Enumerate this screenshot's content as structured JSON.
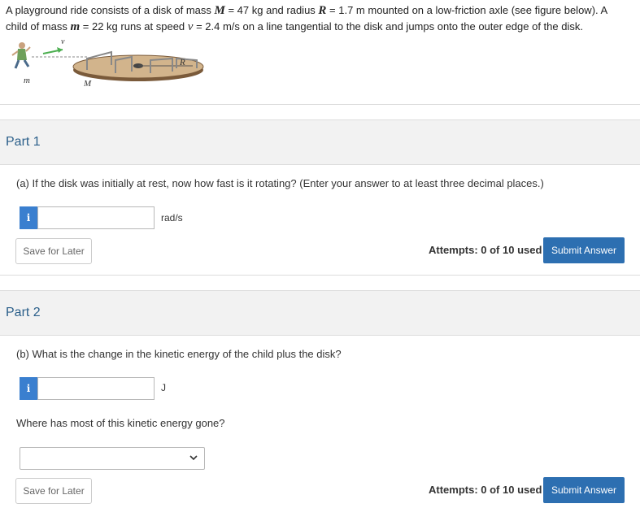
{
  "problem": {
    "t1": "A playground ride consists of a disk of mass ",
    "var_M": "M",
    "eq1": " = 47 kg and radius ",
    "var_R": "R",
    "eq2": " = 1.7 m mounted on a low-friction axle (see figure below). A",
    "t2": "child of mass ",
    "var_m": "m",
    "eq3": " = 22 kg runs at speed ",
    "var_v": "v",
    "eq4": " = 2.4 m/s on a line tangential to the disk and jumps onto the outer edge of the disk."
  },
  "figure": {
    "label_v": "v",
    "label_m": "m",
    "label_M": "M",
    "label_R": "R"
  },
  "part1": {
    "header": "Part 1",
    "question": "(a) If the disk was initially at rest, now how fast is it rotating? (Enter your answer to at least three decimal places.)",
    "info_label": "i",
    "answer_value": "",
    "unit": "rad/s",
    "save_label": "Save for Later",
    "attempts": "Attempts: 0 of 10 used",
    "submit_label": "Submit Answer"
  },
  "part2": {
    "header": "Part 2",
    "question": "(b) What is the change in the kinetic energy of the child plus the disk?",
    "info_label": "i",
    "answer_value": "",
    "unit": "J",
    "question2": "Where has most of this kinetic energy gone?",
    "select_value": "",
    "save_label": "Save for Later",
    "attempts": "Attempts: 0 of 10 used",
    "submit_label": "Submit Answer"
  },
  "colors": {
    "accent": "#2d6fb1",
    "info": "#3a7fcf",
    "part_header_text": "#2b5f8a"
  }
}
